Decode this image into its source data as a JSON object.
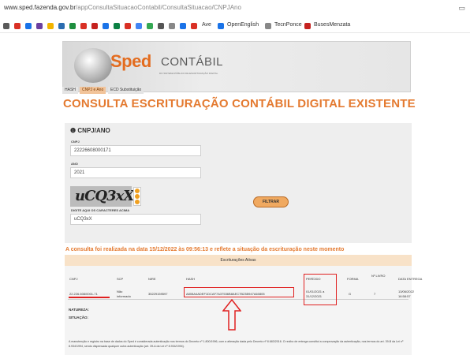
{
  "browser": {
    "url_host": "www.sped.fazenda.gov.br",
    "url_path": "/appConsultaSituacaoContabil/ConsultaSituacao/CNPJAno",
    "bookmarks": [
      {
        "label": "Ave"
      },
      {
        "label": "OpenEnglish"
      },
      {
        "label": "TecnPonce"
      },
      {
        "label": "BusesMenzata"
      }
    ]
  },
  "banner": {
    "brand_sped": "Sped",
    "brand_contabil": "CONTÁBIL",
    "brand_sub": "DO SISTEMA PÚBLICO DE ESCRITURAÇÃO DIGITAL"
  },
  "tabs": [
    "HASH",
    "CNPJ e Ano",
    "ECD Substituição"
  ],
  "page_title": "CONSULTA ESCRITURAÇÃO CONTÁBIL DIGITAL EXISTENTE",
  "form": {
    "section_title": "CNPJ/ANO",
    "cnpj_label": "CNPJ",
    "cnpj_value": "22226608000171",
    "ano_label": "ANO",
    "ano_value": "2021",
    "captcha_text": "uCQ3xX",
    "captcha_label": "DIGITE AQUI OS CARACTERES ACIMA",
    "captcha_value": "uCQ3xX",
    "submit_label": "FILTRAR"
  },
  "notice": "A consulta foi realizada na data 15/12/2022 às 09:56:13 e reflete a situação da escrituração neste momento",
  "results": {
    "caption": "Escriturações Ativas",
    "columns": [
      "CNPJ",
      "SCP",
      "NIRE",
      "HASH",
      "PERÍODO",
      "FORMA",
      "Nº LIVRO",
      "DATA ENTREGA"
    ],
    "row": {
      "cnpj": "22.226.608/0001-71",
      "scp_1": "Não",
      "scp_2": "informado",
      "nire": "35229159597",
      "hash": "A808A4ADEF1DCAF7A37536B8AEC7B23B947A60805",
      "periodo_1": "01/01/2021 a",
      "periodo_2": "31/12/2021",
      "forma": "G",
      "livro": "7",
      "entrega_1": "13/06/2022",
      "entrega_2": "16:58:57"
    },
    "natureza_label": "NATUREZA:",
    "situacao_label": "SITUAÇÃO:",
    "note": "A manutenção e registro na base de dados do Sped é considerada autenticação nos termos do Decreto nº 1.800/1996, com a alteração dada pelo Decreto nº 8.683/2016. O recibo de entrega constitui a comprovação da autenticação, nos termos do art. 39-B da Lei nº 8.934/1994, sendo dispensada qualquer outra autenticação (art. 39-A da Lei nº 8.934/1994)."
  },
  "colors": {
    "accent_orange": "#e47a30",
    "annotation_red": "#e02020",
    "button_orange": "#f0a960"
  }
}
